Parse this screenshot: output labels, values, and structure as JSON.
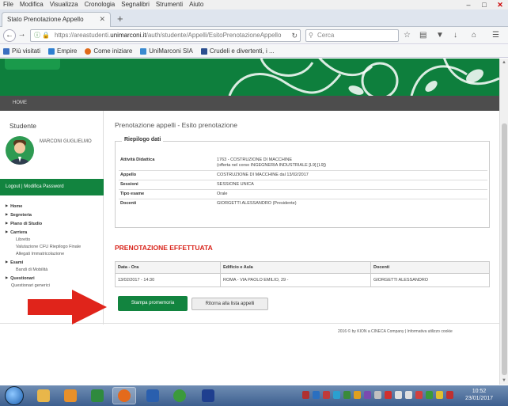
{
  "menubar": {
    "items": [
      "File",
      "Modifica",
      "Visualizza",
      "Cronologia",
      "Segnalibri",
      "Strumenti",
      "Aiuto"
    ]
  },
  "tab": {
    "title": "Stato Prenotazione Appello"
  },
  "navbar": {
    "url_prefix": "https://areastudenti.",
    "url_domain": "unimarconi.it",
    "url_path": "/auth/studente/Appelli/EsitoPrenotazioneAppello",
    "search_placeholder": "Cerca"
  },
  "bookmarks": [
    {
      "label": "Più visitati",
      "color": "#3a6fc0"
    },
    {
      "label": "Empire",
      "color": "#2f7fd0"
    },
    {
      "label": "Come iniziare",
      "color": "#e06a1a"
    },
    {
      "label": "UniMarconi SIA",
      "color": "#3a8ad0"
    },
    {
      "label": "Crudeli e divertenti, i ...",
      "color": "#2b4f8f"
    }
  ],
  "header": {
    "home_label": "HOME"
  },
  "sidebar": {
    "title": "Studente",
    "student_name": "MARCONI GUGLIELMO",
    "logout": "Logout",
    "change_password": "Modifica Password",
    "menu": [
      {
        "label": "Home",
        "level": "main"
      },
      {
        "label": "Segreteria",
        "level": "main"
      },
      {
        "label": "Piano di Studio",
        "level": "main"
      },
      {
        "label": "Carriera",
        "level": "main"
      },
      {
        "label": "Libretto",
        "level": "sub"
      },
      {
        "label": "Valutazione CFU Riepilogo Finale",
        "level": "sub"
      },
      {
        "label": "Allegati Immatricolazione",
        "level": "sub"
      },
      {
        "label": "Esami",
        "level": "main"
      },
      {
        "label": "Bandi di Mobilità",
        "level": "sub"
      },
      {
        "label": "Questionari",
        "level": "main"
      },
      {
        "label": "Questionari generici",
        "level": "sub2"
      }
    ]
  },
  "main": {
    "page_title": "Prenotazione appelli - Esito prenotazione",
    "summary_legend": "Riepilogo dati",
    "summary": [
      {
        "key": "Attività Didattica",
        "value": "1763 - COSTRUZIONE DI MACCHINE",
        "value2": "(offerta nel corso INGEGNERIA INDUSTRIALE [L9] [L9])"
      },
      {
        "key": "Appello",
        "value": "COSTRUZIONE DI MACCHINE dal 13/02/2017",
        "value2": ""
      },
      {
        "key": "Sessioni",
        "value": "SESSIONE UNICA",
        "value2": ""
      },
      {
        "key": "Tipo esame",
        "value": "Orale",
        "value2": ""
      },
      {
        "key": "Docenti",
        "value": "GIORGETTI ALESSANDRO (Presidente)",
        "value2": ""
      }
    ],
    "confirmation": "PRENOTAZIONE EFFETTUATA",
    "table_headers": [
      "Data - Ora",
      "Edificio e Aula",
      "Docenti"
    ],
    "table_rows": [
      [
        "13/02/2017 - 14:30",
        "ROMA - VIA PAOLO EMILIO, 29 -",
        "GIORGETTI ALESSANDRO"
      ]
    ],
    "print_button": "Stampa promemoria",
    "back_button": "Ritorna alla lista appelli"
  },
  "footer": {
    "text": "2016 © by KION a CINECA Company | Informativa utilizzo cookie"
  },
  "taskbar": {
    "time": "10:52",
    "date": "23/01/2017",
    "apps": [
      {
        "name": "explorer",
        "color": "#e8b64a"
      },
      {
        "name": "outlook",
        "color": "#e8902a"
      },
      {
        "name": "excel",
        "color": "#2f8a3e"
      },
      {
        "name": "firefox",
        "color": "#e46a1c"
      },
      {
        "name": "word",
        "color": "#2a5fae"
      },
      {
        "name": "chrome",
        "color": "#3b9a3b"
      },
      {
        "name": "unimarconi",
        "color": "#1f3f8f"
      }
    ]
  },
  "colors": {
    "brand_green": "#12843f",
    "confirm_red": "#d9251c",
    "arrow_red": "#e0241b"
  }
}
